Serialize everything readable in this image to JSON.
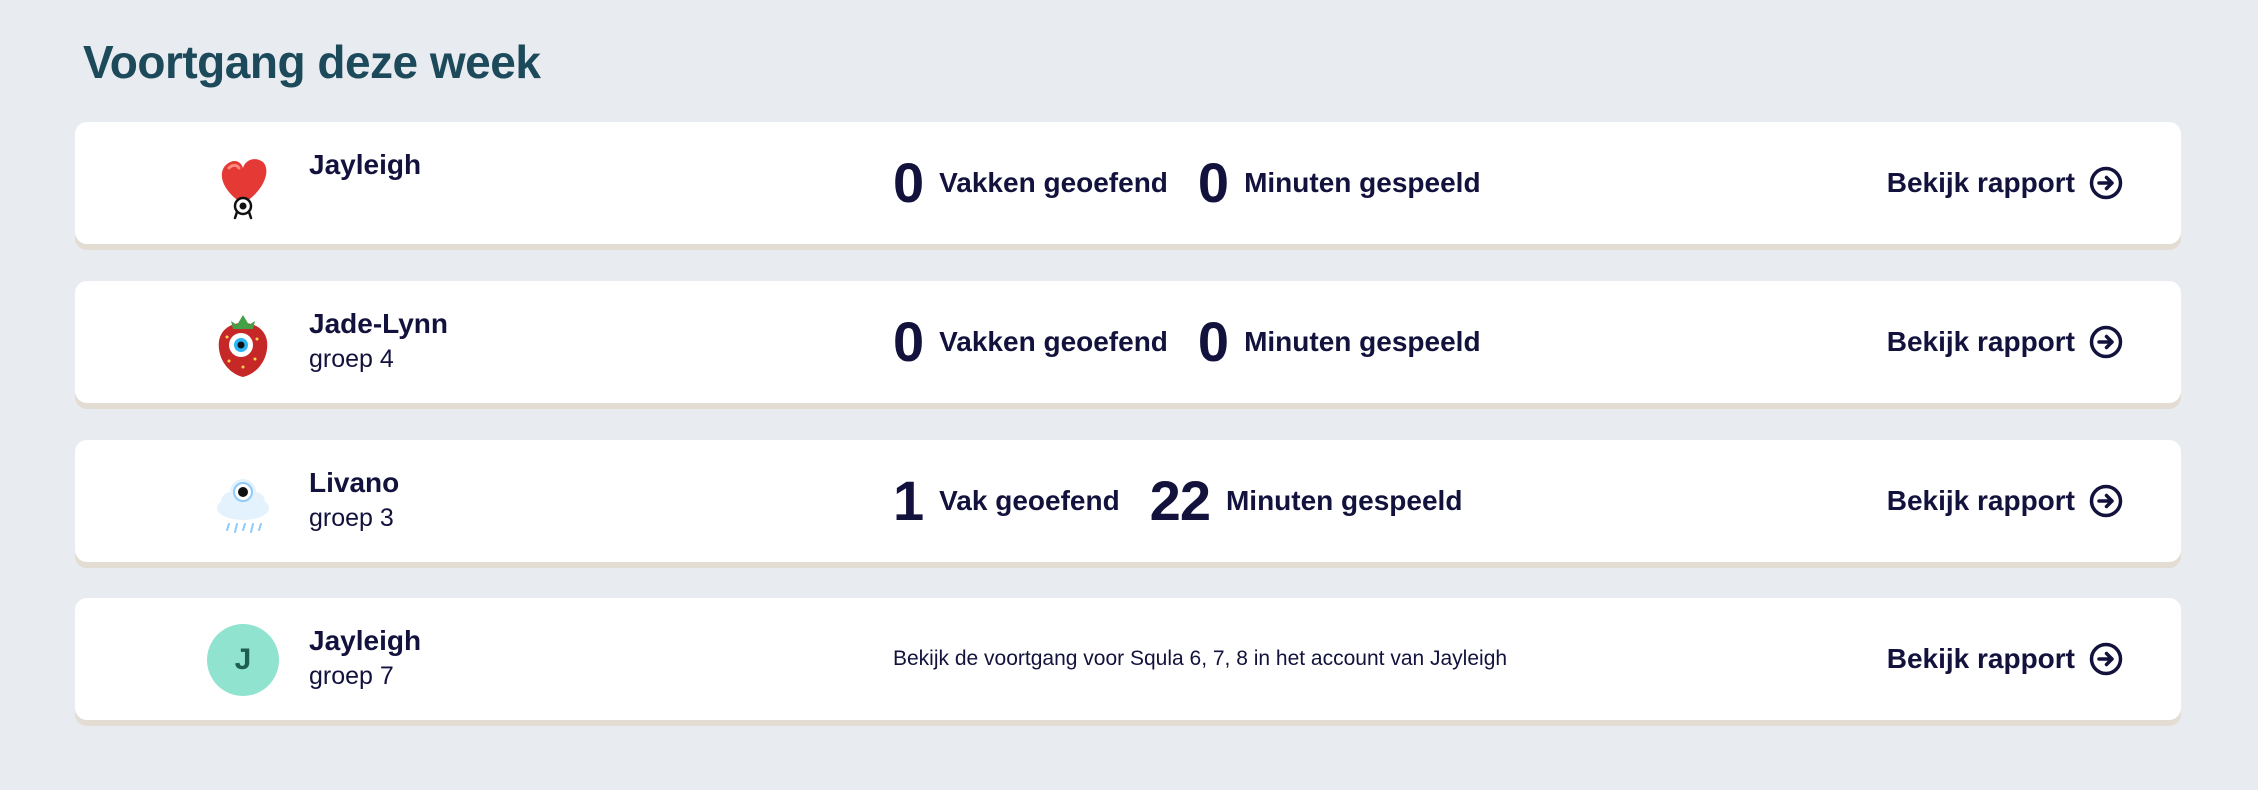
{
  "page": {
    "title": "Voortgang deze week"
  },
  "children": [
    {
      "name": "Jayleigh",
      "group": "",
      "avatar": "red-heart-creature",
      "subjects_count": "0",
      "subjects_label": "Vakken geoefend",
      "minutes_count": "0",
      "minutes_label": "Minuten gespeeld",
      "report_label": "Bekijk rapport"
    },
    {
      "name": "Jade-Lynn",
      "group": "groep 4",
      "avatar": "strawberry-creature",
      "subjects_count": "0",
      "subjects_label": "Vakken geoefend",
      "minutes_count": "0",
      "minutes_label": "Minuten gespeeld",
      "report_label": "Bekijk rapport"
    },
    {
      "name": "Livano",
      "group": "groep 3",
      "avatar": "cloud-creature",
      "subjects_count": "1",
      "subjects_label": "Vak geoefend",
      "minutes_count": "22",
      "minutes_label": "Minuten gespeeld",
      "report_label": "Bekijk rapport"
    },
    {
      "name": "Jayleigh",
      "group": "groep 7",
      "avatar_initial": "J",
      "note": "Bekijk de voortgang voor Squla 6, 7, 8 in het account van Jayleigh",
      "report_label": "Bekijk rapport"
    }
  ],
  "colors": {
    "background": "#e8ebf0",
    "title": "#1c4a5b",
    "text": "#12123d",
    "initial_avatar": "#8fe3cf",
    "card_shadow": "#e2dcd3"
  }
}
